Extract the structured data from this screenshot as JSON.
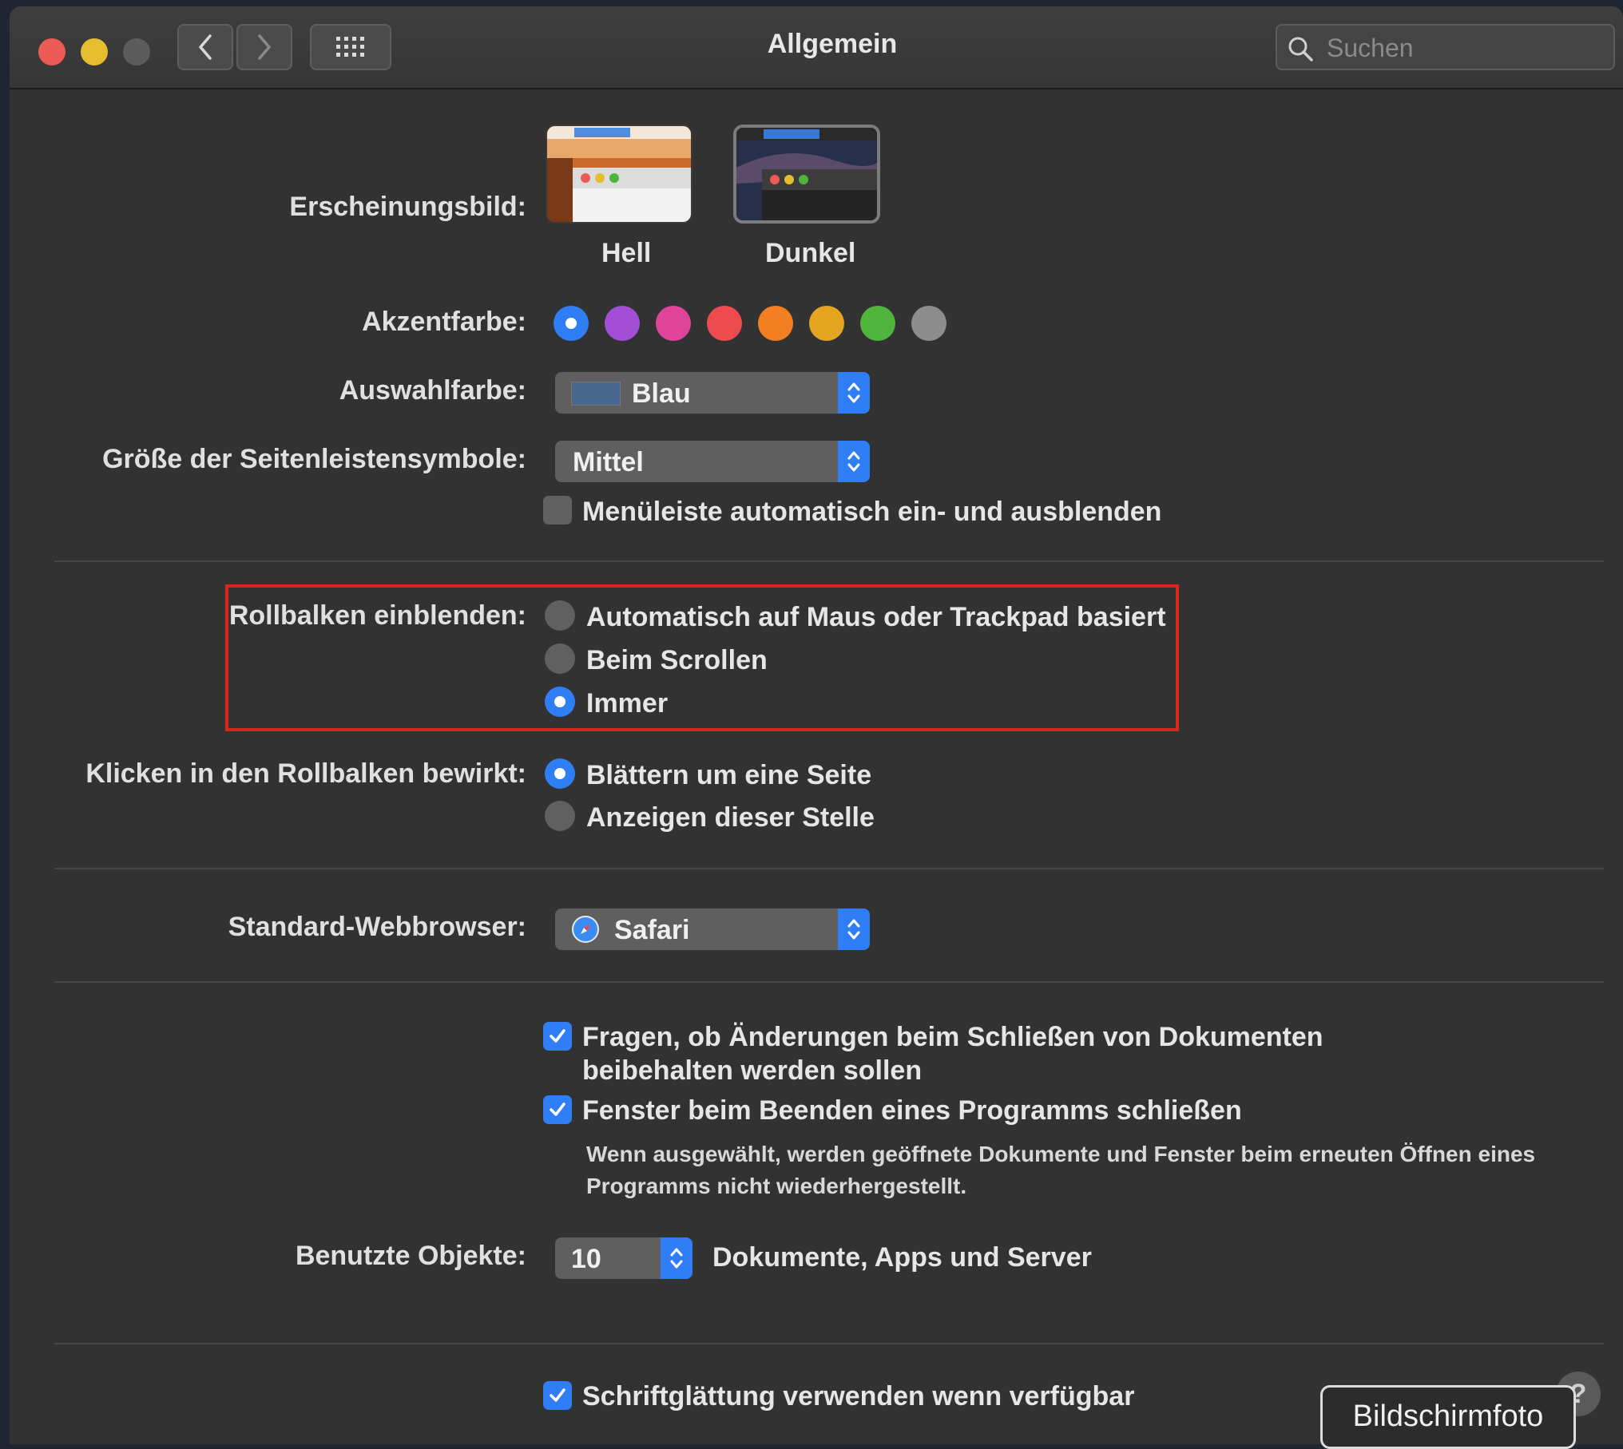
{
  "window": {
    "title": "Allgemein",
    "search_placeholder": "Suchen"
  },
  "appearance": {
    "label": "Erscheinungsbild:",
    "options": [
      {
        "label": "Hell",
        "selected": false
      },
      {
        "label": "Dunkel",
        "selected": true
      }
    ]
  },
  "accent": {
    "label": "Akzentfarbe:",
    "colors": [
      "#2f7ef5",
      "#a24fd6",
      "#e0449a",
      "#ee4b4f",
      "#f28022",
      "#e5a521",
      "#4fb43b",
      "#8d8d8d"
    ],
    "selected_index": 0
  },
  "highlight": {
    "label": "Auswahlfarbe:",
    "value": "Blau",
    "swatch_color": "#4a6790"
  },
  "sidebar_icon_size": {
    "label": "Größe der Seitenleistensymbole:",
    "value": "Mittel"
  },
  "menubar_autohide": {
    "label": "Menüleiste automatisch ein- und ausblenden",
    "checked": false
  },
  "show_scrollbars": {
    "label": "Rollbalken einblenden:",
    "options": [
      {
        "label": "Automatisch auf Maus oder Trackpad basiert",
        "selected": false
      },
      {
        "label": "Beim Scrollen",
        "selected": false
      },
      {
        "label": "Immer",
        "selected": true
      }
    ]
  },
  "click_scrollbar": {
    "label": "Klicken in den Rollbalken bewirkt:",
    "options": [
      {
        "label": "Blättern um eine Seite",
        "selected": true
      },
      {
        "label": "Anzeigen dieser Stelle",
        "selected": false
      }
    ]
  },
  "default_browser": {
    "label": "Standard-Webbrowser:",
    "value": "Safari"
  },
  "ask_keep_changes": {
    "label_line1": "Fragen, ob Änderungen beim Schließen von Dokumenten",
    "label_line2": "beibehalten werden sollen",
    "checked": true
  },
  "close_windows": {
    "label": "Fenster beim Beenden eines Programms schließen",
    "checked": true,
    "note_line1": "Wenn ausgewählt, werden geöffnete Dokumente und Fenster beim erneuten Öffnen eines",
    "note_line2": "Programms nicht wiederhergestellt."
  },
  "recent_items": {
    "label": "Benutzte Objekte:",
    "value": "10",
    "suffix": "Dokumente, Apps und Server"
  },
  "font_smoothing": {
    "label": "Schriftglättung verwenden wenn verfügbar",
    "checked": true
  },
  "overlay": {
    "screenshot_label": "Bildschirmfoto",
    "help_label": "?"
  }
}
